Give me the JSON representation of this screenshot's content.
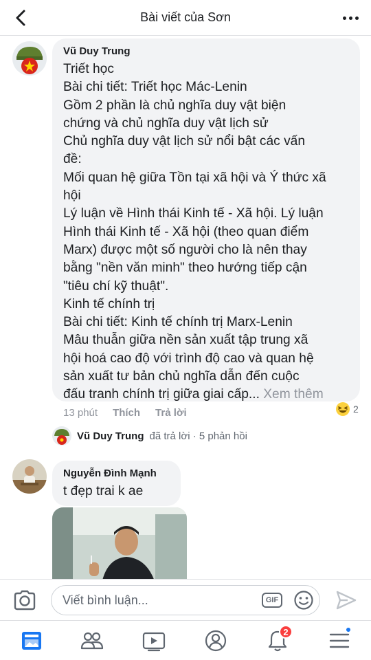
{
  "header": {
    "title": "Bài viết của Sơn",
    "back_icon": "chevron-left-icon",
    "more_icon": "ellipsis-icon"
  },
  "comments": [
    {
      "author": "Vũ Duy Trung",
      "text": "Triết học\nBài chi tiết: Triết học Mác-Lenin\nGồm 2 phần là chủ nghĩa duy vật biện\nchứng và chủ nghĩa duy vật lịch sử\nChủ nghĩa duy vật lịch sử nổi bật các vấn\nđề:\nMối quan hệ giữa Tồn tại xã hội và Ý thức xã\nhội\nLý luận về Hình thái Kinh tế - Xã hội. Lý luận\nHình thái Kinh tế - Xã hội (theo quan điểm\nMarx) được một số người cho là nên thay\nbằng \"nền văn minh\" theo hướng tiếp cận\n\"tiêu chí kỹ thuật\".\nKinh tế chính trị\nBài chi tiết: Kinh tế chính trị Marx-Lenin\nMâu thuẫn giữa nền sản xuất tập trung xã\nhội hoá cao độ với trình độ cao và quan hệ\nsản xuất tư bản chủ nghĩa dẫn đến cuộc\nđấu tranh chính trị giữa giai cấp...",
      "see_more": " Xem thêm",
      "time": "13 phút",
      "like_label": "Thích",
      "reply_label": "Trả lời",
      "reaction_count": "2",
      "reaction_icon": "haha-emoji-icon",
      "reply_summary": {
        "name": "Vũ Duy Trung",
        "text": "đã trả lời · 5 phản hồi"
      }
    },
    {
      "author": "Nguyễn Đình Mạnh",
      "text": "t đẹp trai k ae",
      "attachment": "photo"
    }
  ],
  "composer": {
    "placeholder": "Viết bình luận...",
    "gif_label": "GIF",
    "camera_icon": "camera-icon",
    "emoji_icon": "smiley-icon",
    "send_icon": "send-icon"
  },
  "bottom_nav": {
    "items": [
      "news-feed-icon",
      "groups-icon",
      "watch-icon",
      "profile-icon",
      "bell-icon",
      "menu-icon"
    ],
    "notifications_badge": "2"
  },
  "colors": {
    "bubble": "#f2f3f5",
    "accent": "#1877f2",
    "badge": "#fa3e3e",
    "meta_text": "#90949c"
  }
}
